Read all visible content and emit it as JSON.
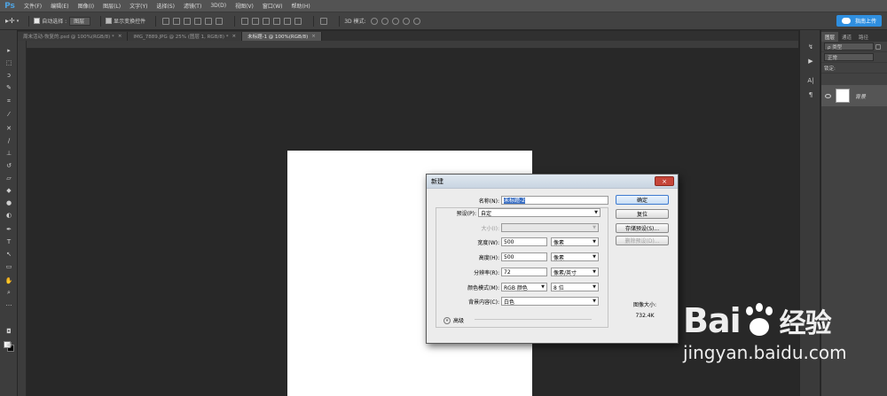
{
  "app": {
    "logo": "Ps"
  },
  "menu": [
    "文件(F)",
    "编辑(E)",
    "图像(I)",
    "图层(L)",
    "文字(Y)",
    "选择(S)",
    "滤镜(T)",
    "3D(D)",
    "视图(V)",
    "窗口(W)",
    "帮助(H)"
  ],
  "options_bar": {
    "auto_select_label": "自动选择 :",
    "auto_select_value": "图层",
    "show_transform_label": "显示变换控件",
    "mode_3d_label": "3D 模式:",
    "share_button": "指南上传"
  },
  "tabs": [
    {
      "label": "周末活动-恢复的.psd @ 100%(RGB/8) *",
      "active": false
    },
    {
      "label": "IMG_7889.JPG @ 25% (图层 1, RGB/8) *",
      "active": false
    },
    {
      "label": "未标题-1 @ 100%(RGB/8)",
      "active": true
    }
  ],
  "layers_panel": {
    "tabs": [
      "图层",
      "通道",
      "路径"
    ],
    "filter_label": "ρ 类型",
    "blend_mode": "正常",
    "lock_label": "锁定:",
    "layer_name": "背景"
  },
  "dialog": {
    "title": "新建",
    "close": "×",
    "name_label": "名称(N):",
    "name_value": "未标题-2",
    "preset_label": "预设(P):",
    "preset_value": "自定",
    "size_label": "大小(I):",
    "size_value": "",
    "width_label": "宽度(W):",
    "width_value": "500",
    "width_unit": "像素",
    "height_label": "高度(H):",
    "height_value": "500",
    "height_unit": "像素",
    "resolution_label": "分辨率(R):",
    "resolution_value": "72",
    "resolution_unit": "像素/英寸",
    "color_mode_label": "颜色模式(M):",
    "color_mode_value": "RGB 颜色",
    "bit_depth": "8 位",
    "background_label": "背景内容(C):",
    "background_value": "白色",
    "advanced_label": "高级",
    "ok_button": "确定",
    "reset_button": "复位",
    "save_preset_button": "存储预设(S)...",
    "delete_preset_button": "删除预设(D)...",
    "image_size_label": "图像大小:",
    "image_size_value": "732.4K"
  },
  "watermark": {
    "logo_left": "Bai",
    "logo_right": "经验",
    "url": "jingyan.baidu.com"
  },
  "colors": {
    "accent": "#2f8fe0",
    "workspace": "#282828",
    "panel": "#424242"
  }
}
